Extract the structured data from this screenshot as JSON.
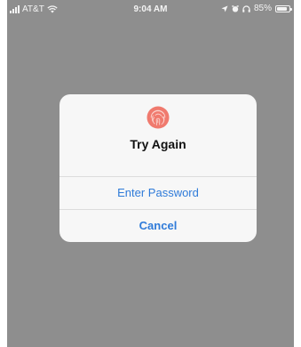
{
  "status_bar": {
    "carrier": "AT&T",
    "time": "9:04 AM",
    "battery": "85%",
    "icons": [
      "signal-icon",
      "wifi-icon",
      "location-icon",
      "alarm-icon",
      "headphones-icon",
      "battery-icon"
    ]
  },
  "alert": {
    "icon": "fingerprint-icon",
    "title": "Try Again",
    "buttons": {
      "enter_password": "Enter Password",
      "cancel": "Cancel"
    }
  },
  "colors": {
    "overlay": "#8e8e8e",
    "alert_bg": "#f7f7f7",
    "button_text": "#2f7bd9",
    "fingerprint": "#f07a6e"
  }
}
